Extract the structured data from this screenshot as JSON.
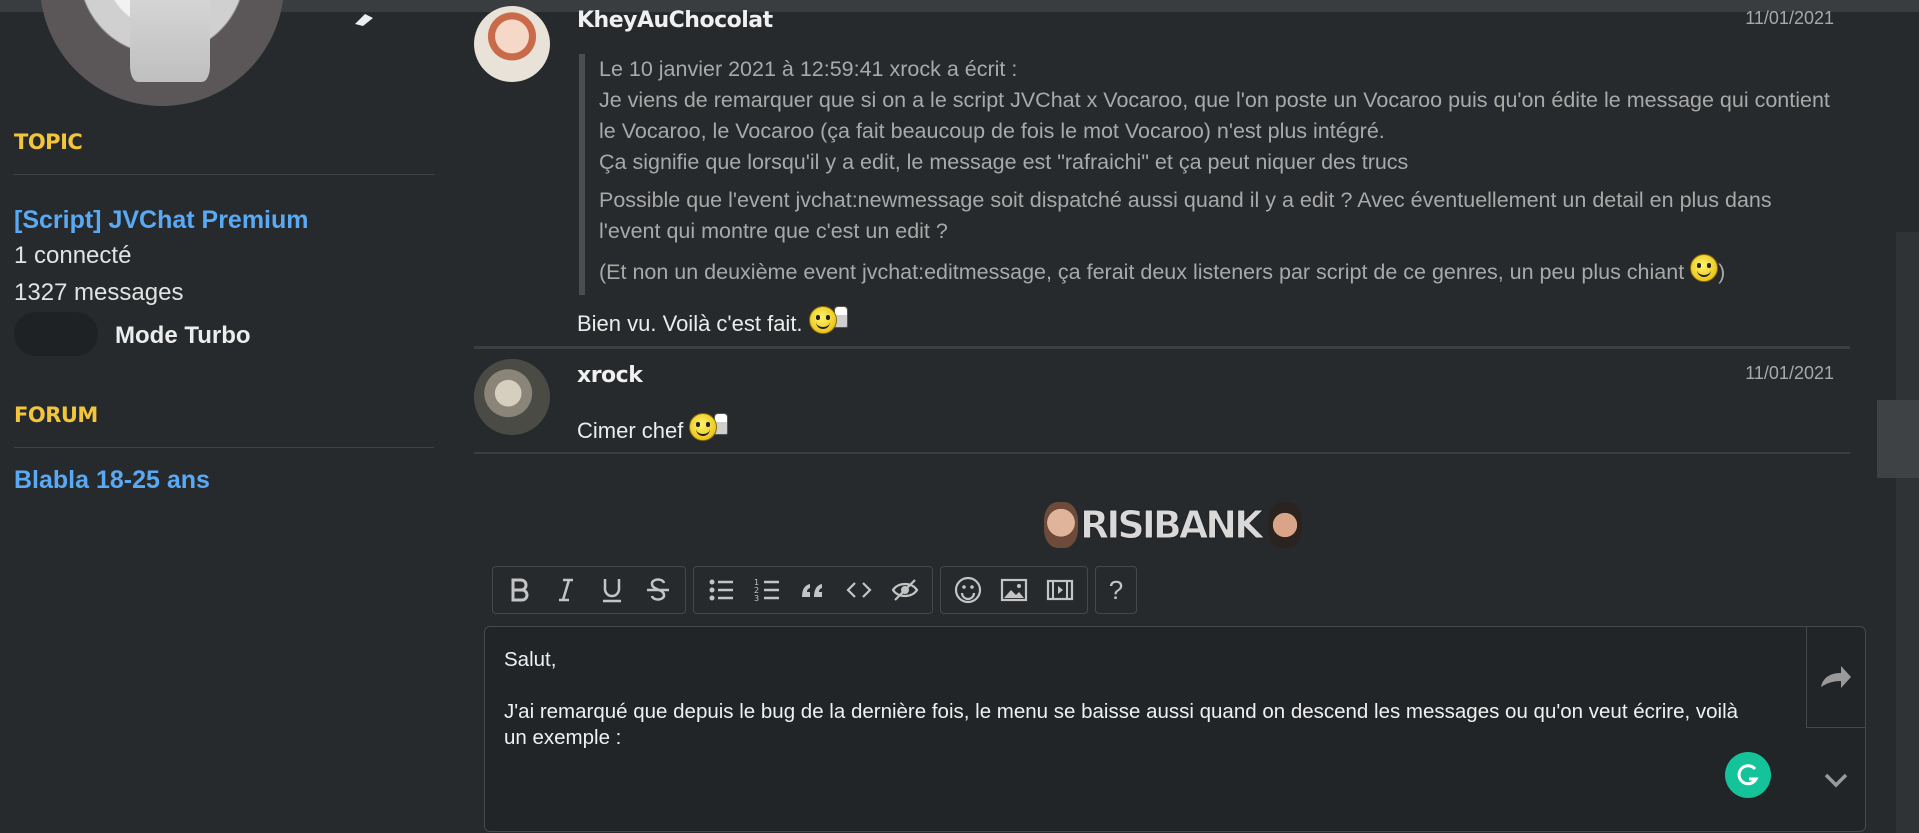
{
  "sidebar": {
    "topic_heading": "TOPIC",
    "topic_title": "[Script] JVChat Premium",
    "connected": "1 connecté",
    "messages": "1327 messages",
    "turbo_label": "Mode Turbo",
    "forum_heading": "FORUM",
    "forum_name": "Blabla 18-25 ans"
  },
  "messages": [
    {
      "author": "KheyAuChocolat",
      "date": "11/01/2021",
      "quote": {
        "header": "Le 10 janvier 2021 à 12:59:41 xrock a écrit :",
        "line1": "Je viens de remarquer que si on a le script JVChat x Vocaroo, que l'on poste un Vocaroo puis qu'on édite le message qui contient le Vocaroo, le Vocaroo (ça fait beaucoup de fois le mot Vocaroo) n'est plus intégré.",
        "line2": "Ça signifie que lorsqu'il y a edit, le message est \"rafraichi\" et ça peut niquer des trucs",
        "line3": "Possible que l'event jvchat:newmessage soit dispatché aussi quand il y a edit ? Avec éventuellement un detail en plus dans l'event qui montre que c'est un edit ?",
        "line4": "(Et non un deuxième event jvchat:editmessage, ça ferait deux listeners par script de ce genres, un peu plus chiant",
        "line4_end": ")"
      },
      "text": "Bien vu. Voilà c'est fait."
    },
    {
      "author": "xrock",
      "date": "11/01/2021",
      "text": "Cimer chef"
    }
  ],
  "risibank": {
    "logo_text": "RISIBANK"
  },
  "toolbar": {
    "help_label": "?"
  },
  "editor": {
    "line1": "Salut,",
    "line2": "J'ai remarqué que depuis le bug de la dernière fois, le menu se baisse aussi quand on descend les messages ou qu'on veut écrire, voilà un exemple :"
  },
  "icons": {
    "bold": "bold-icon",
    "italic": "italic-icon",
    "underline": "underline-icon",
    "strike": "strikethrough-icon",
    "bullets": "bullet-list-icon",
    "numbered": "numbered-list-icon",
    "quote": "quote-icon",
    "code": "code-icon",
    "spoiler": "spoiler-icon",
    "smiley": "smiley-icon",
    "image": "image-icon",
    "video": "video-icon",
    "send": "send-icon",
    "chevron": "chevron-down-icon",
    "grammarly": "grammarly-icon"
  },
  "colors": {
    "background": "#262a2c",
    "accent_yellow": "#f3c53a",
    "link_blue": "#59a9f5",
    "grammarly_green": "#15c39a"
  }
}
